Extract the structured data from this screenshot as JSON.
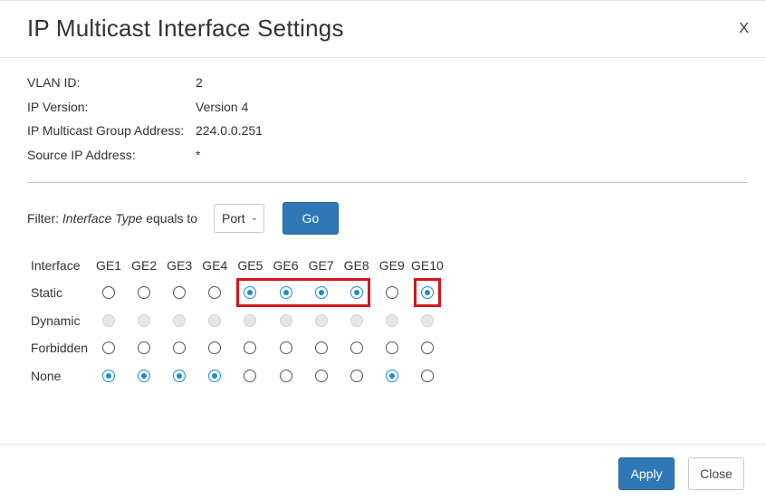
{
  "dialog": {
    "title": "IP Multicast Interface Settings",
    "close_glyph": "X"
  },
  "info": [
    {
      "label": "VLAN ID:",
      "value": "2"
    },
    {
      "label": "IP Version:",
      "value": "Version 4"
    },
    {
      "label": "IP Multicast Group Address:",
      "value": "224.0.0.251"
    },
    {
      "label": "Source IP Address:",
      "value": "*"
    }
  ],
  "filter": {
    "prefix": "Filter:",
    "field": "Interface Type",
    "operator": "equals to",
    "selected": "Port",
    "go_label": "Go"
  },
  "table": {
    "corner_label": "Interface",
    "interfaces": [
      "GE1",
      "GE2",
      "GE3",
      "GE4",
      "GE5",
      "GE6",
      "GE7",
      "GE8",
      "GE9",
      "GE10"
    ],
    "rows": [
      "Static",
      "Dynamic",
      "Forbidden",
      "None"
    ],
    "selection": [
      "None",
      "None",
      "None",
      "None",
      "Static",
      "Static",
      "Static",
      "Static",
      "None",
      "Static"
    ],
    "disabled_rows": [
      "Dynamic"
    ],
    "highlighted_groups": [
      [
        "GE5",
        "GE6",
        "GE7",
        "GE8"
      ],
      [
        "GE10"
      ]
    ],
    "accent_color": "#1f8ad0",
    "highlight_color": "#d2161e"
  },
  "footer": {
    "apply_label": "Apply",
    "close_label": "Close"
  },
  "colors": {
    "primary_button": "#2f78b8"
  }
}
